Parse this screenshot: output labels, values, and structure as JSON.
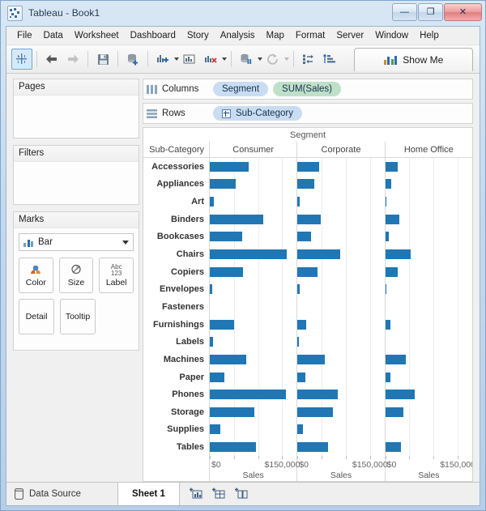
{
  "window": {
    "title": "Tableau - Book1",
    "app_icon": "tableau-icon",
    "buttons": [
      {
        "name": "minimize-button",
        "glyph": "—"
      },
      {
        "name": "maximize-button",
        "glyph": "❐"
      },
      {
        "name": "close-button",
        "glyph": "✕"
      }
    ]
  },
  "menubar": {
    "items": [
      "File",
      "Data",
      "Worksheet",
      "Dashboard",
      "Story",
      "Analysis",
      "Map",
      "Format",
      "Server",
      "Window",
      "Help"
    ]
  },
  "toolbar": {
    "buttons": [
      {
        "name": "tableau-home-button",
        "icon": "tableau-sparkle-icon",
        "selected": true
      },
      {
        "name": "back-button",
        "icon": "arrow-left-icon"
      },
      {
        "name": "forward-button",
        "icon": "arrow-right-icon"
      },
      {
        "name": "save-button",
        "icon": "floppy-disk-icon"
      },
      {
        "name": "connect-new-data-source-button",
        "icon": "data-source-add-icon"
      },
      {
        "name": "new-worksheet-button",
        "icon": "new-worksheet-icon"
      },
      {
        "name": "duplicate-sheet-button",
        "icon": "duplicate-sheet-icon"
      },
      {
        "name": "clear-sheet-button",
        "icon": "clear-sheet-icon"
      },
      {
        "name": "pause-auto-update-button",
        "icon": "pause-updates-icon"
      },
      {
        "name": "refresh-button",
        "icon": "refresh-icon"
      },
      {
        "name": "swap-rows-columns-button",
        "icon": "swap-axes-icon"
      },
      {
        "name": "sort-ascending-button",
        "icon": "sort-asc-icon"
      }
    ],
    "show_me_label": "Show Me",
    "show_me_icon": "show-me-bars-icon"
  },
  "left_panel": {
    "pages": {
      "title": "Pages",
      "content": ""
    },
    "filters": {
      "title": "Filters",
      "content": ""
    },
    "marks": {
      "title": "Marks",
      "mark_type": "Bar",
      "mark_type_icon": "bar-mark-icon",
      "buttons": [
        {
          "name": "marks-color-button",
          "label": "Color",
          "icon": "color-palette-icon"
        },
        {
          "name": "marks-size-button",
          "label": "Size",
          "icon": "size-circle-icon"
        },
        {
          "name": "marks-label-button",
          "label": "Label",
          "icon": "abc-123-icon"
        },
        {
          "name": "marks-detail-button",
          "label": "Detail",
          "icon": "detail-icon"
        },
        {
          "name": "marks-tooltip-button",
          "label": "Tooltip",
          "icon": "tooltip-icon"
        }
      ],
      "label_icon_top": "Abc",
      "label_icon_bottom": "123"
    }
  },
  "shelves": {
    "columns": {
      "label": "Columns",
      "icon": "columns-shelf-icon",
      "pills": [
        {
          "text": "Segment",
          "kind": "dimension",
          "expandable": false
        },
        {
          "text": "SUM(Sales)",
          "kind": "measure",
          "expandable": false
        }
      ]
    },
    "rows": {
      "label": "Rows",
      "icon": "rows-shelf-icon",
      "pills": [
        {
          "text": "Sub-Category",
          "kind": "dimension",
          "expandable": true
        }
      ]
    }
  },
  "chart_data": {
    "type": "bar",
    "title": "Segment",
    "row_header_label": "Sub-Category",
    "xlabel": "Sales",
    "ylabel": "Sub-Category",
    "xlim": [
      0,
      180000
    ],
    "xticks": [
      0,
      50000,
      100000,
      150000
    ],
    "xtick_labels": [
      "$0",
      "",
      "",
      "$150,000"
    ],
    "grid": true,
    "legend": "none",
    "bar_color": "#2077b4",
    "categories": [
      "Accessories",
      "Appliances",
      "Art",
      "Binders",
      "Bookcases",
      "Chairs",
      "Copiers",
      "Envelopes",
      "Fasteners",
      "Furnishings",
      "Labels",
      "Machines",
      "Paper",
      "Phones",
      "Storage",
      "Supplies",
      "Tables"
    ],
    "panels": [
      "Consumer",
      "Corporate",
      "Home Office"
    ],
    "series": [
      {
        "name": "Consumer",
        "values": [
          81000,
          53000,
          8000,
          110000,
          67000,
          160000,
          68000,
          5500,
          0,
          50000,
          6000,
          75000,
          31000,
          158000,
          93000,
          21000,
          96000
        ]
      },
      {
        "name": "Corporate",
        "values": [
          44000,
          34000,
          4000,
          48000,
          28000,
          88000,
          42000,
          4500,
          0,
          18000,
          3000,
          57000,
          17000,
          83000,
          73000,
          11000,
          63000
        ]
      },
      {
        "name": "Home Office",
        "values": [
          25000,
          13000,
          2500,
          29000,
          7000,
          53000,
          26000,
          3000,
          0,
          11000,
          0,
          42000,
          11000,
          61000,
          37000,
          0,
          33000
        ]
      }
    ]
  },
  "bottom_bar": {
    "data_source_label": "Data Source",
    "data_source_icon": "database-icon",
    "active_sheet": "Sheet 1",
    "new_tabs": [
      {
        "name": "new-worksheet-tab-button",
        "icon": "new-worksheet-icon"
      },
      {
        "name": "new-dashboard-tab-button",
        "icon": "new-dashboard-icon"
      },
      {
        "name": "new-story-tab-button",
        "icon": "new-story-icon"
      }
    ]
  }
}
